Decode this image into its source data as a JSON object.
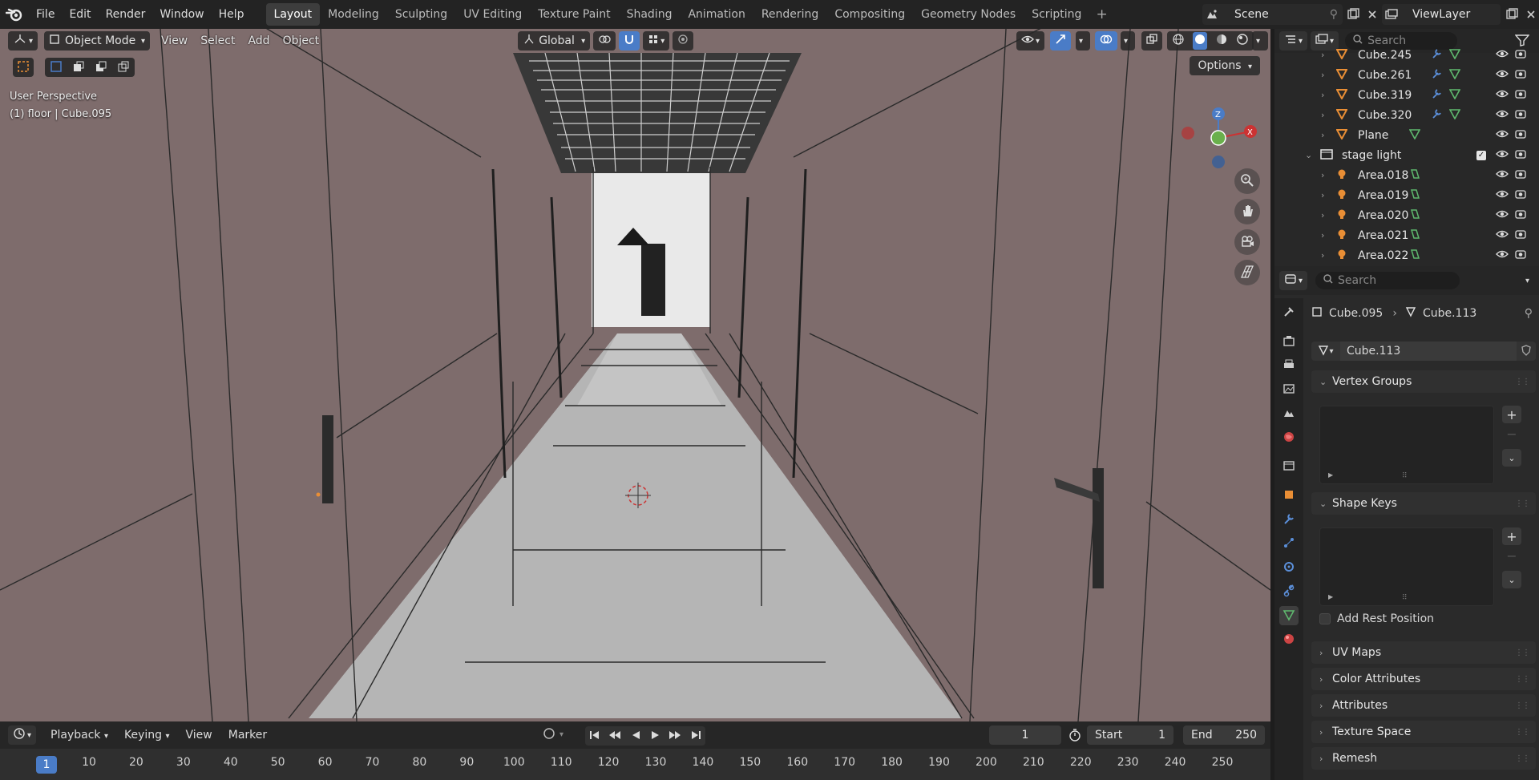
{
  "menubar": {
    "items": [
      "File",
      "Edit",
      "Render",
      "Window",
      "Help"
    ],
    "workspaces": [
      "Layout",
      "Modeling",
      "Sculpting",
      "UV Editing",
      "Texture Paint",
      "Shading",
      "Animation",
      "Rendering",
      "Compositing",
      "Geometry Nodes",
      "Scripting"
    ],
    "active_workspace": "Layout",
    "scene": "Scene",
    "view_layer": "ViewLayer"
  },
  "viewport": {
    "mode": "Object Mode",
    "menus": [
      "View",
      "Select",
      "Add",
      "Object"
    ],
    "transform_orientation": "Global",
    "options_label": "Options",
    "info_line1": "User Perspective",
    "info_line2": "(1) floor | Cube.095",
    "gizmo": {
      "z": "Z",
      "x": "X"
    }
  },
  "timeline": {
    "menus": [
      "Playback",
      "Keying",
      "View",
      "Marker"
    ],
    "current_frame": "1",
    "start_label": "Start",
    "start": "1",
    "end_label": "End",
    "end": "250",
    "ruler": [
      "1",
      "10",
      "20",
      "30",
      "40",
      "50",
      "60",
      "70",
      "80",
      "90",
      "100",
      "110",
      "120",
      "130",
      "140",
      "150",
      "160",
      "170",
      "180",
      "190",
      "200",
      "210",
      "220",
      "230",
      "240",
      "250"
    ]
  },
  "outliner": {
    "search_placeholder": "Search",
    "rows": [
      {
        "name": "Cube.245",
        "type": "mesh"
      },
      {
        "name": "Cube.261",
        "type": "mesh"
      },
      {
        "name": "Cube.319",
        "type": "mesh"
      },
      {
        "name": "Cube.320",
        "type": "mesh"
      },
      {
        "name": "Plane",
        "type": "plane"
      },
      {
        "name": "stage light",
        "type": "collection"
      },
      {
        "name": "Area.018",
        "type": "light"
      },
      {
        "name": "Area.019",
        "type": "light"
      },
      {
        "name": "Area.020",
        "type": "light"
      },
      {
        "name": "Area.021",
        "type": "light"
      },
      {
        "name": "Area.022",
        "type": "light"
      }
    ]
  },
  "properties": {
    "search_placeholder": "Search",
    "breadcrumb_object": "Cube.095",
    "breadcrumb_data": "Cube.113",
    "datablock_name": "Cube.113",
    "panels": {
      "vertex_groups": "Vertex Groups",
      "shape_keys": "Shape Keys",
      "add_rest_position": "Add Rest Position",
      "uv_maps": "UV Maps",
      "color_attributes": "Color Attributes",
      "attributes": "Attributes",
      "texture_space": "Texture Space",
      "remesh": "Remesh"
    }
  },
  "colors": {
    "accent_blue": "#4a7cc7",
    "object_orange": "#e98e35",
    "data_green": "#5fb86e",
    "viewport_wall": "#7e6c6c",
    "floor": "#b8b8b8"
  }
}
